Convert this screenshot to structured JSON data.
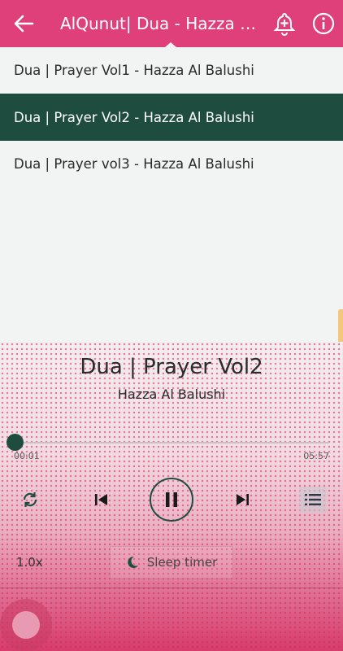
{
  "appbar": {
    "title": "AlQunut| Dua - Hazza Al Balushi",
    "back_icon": "arrow-left-icon",
    "alarm_icon": "add-alarm-icon",
    "info_icon": "info-icon",
    "color": "#e0407a"
  },
  "tracks": [
    {
      "label": "Dua | Prayer Vol1 - Hazza Al Balushi",
      "active": false
    },
    {
      "label": "Dua | Prayer Vol2 - Hazza Al Balushi",
      "active": true
    },
    {
      "label": "Dua | Prayer vol3 - Hazza Al Balushi",
      "active": false
    }
  ],
  "player": {
    "title": "Dua | Prayer Vol2",
    "artist": "Hazza Al Balushi",
    "elapsed": "00:01",
    "duration": "05:57",
    "progress": 0.003,
    "speed": "1.0x",
    "sleep_label": "Sleep timer",
    "accent": "#1e4d40"
  }
}
